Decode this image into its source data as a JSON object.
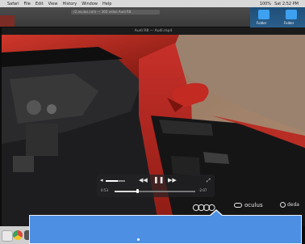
{
  "menubar": {
    "items": [
      "Safari",
      "File",
      "Edit",
      "View",
      "History",
      "Window",
      "Help"
    ],
    "right_items": [
      "100%",
      "Sat 2:52 PM"
    ]
  },
  "browser": {
    "url_text": "r2.oculus.com — 360 video Audi R8"
  },
  "desktop": {
    "icons": [
      {
        "label": "Folder",
        "icon": "folder-icon"
      },
      {
        "label": "Folder",
        "icon": "folder-icon"
      }
    ]
  },
  "player": {
    "title": "Audi R8 — Audi.mp4",
    "elapsed": "0:53",
    "remaining": "-2:07",
    "volume_level": 0.62,
    "progress": 0.28
  },
  "brands": {
    "oculus": "oculus",
    "third": "deda"
  },
  "colors": {
    "banner": "#4c8fe3",
    "car_red": "#b3281f",
    "desktop_blue": "#2b5f8c"
  }
}
